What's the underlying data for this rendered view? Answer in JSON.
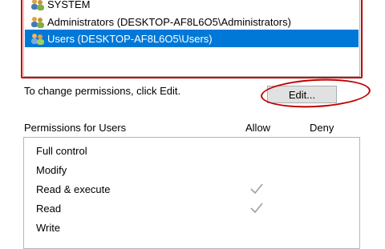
{
  "users": {
    "items": [
      {
        "name": "SYSTEM",
        "selected": false
      },
      {
        "name": "Administrators (DESKTOP-AF8L6O5\\Administrators)",
        "selected": false
      },
      {
        "name": "Users (DESKTOP-AF8L6O5\\Users)",
        "selected": true
      }
    ]
  },
  "hint": "To change permissions, click Edit.",
  "edit_button": "Edit...",
  "permissions": {
    "title": "Permissions for Users",
    "allow_label": "Allow",
    "deny_label": "Deny",
    "rows": [
      {
        "name": "Full control",
        "allow": false,
        "deny": false
      },
      {
        "name": "Modify",
        "allow": false,
        "deny": false
      },
      {
        "name": "Read & execute",
        "allow": true,
        "deny": false
      },
      {
        "name": "Read",
        "allow": true,
        "deny": false
      },
      {
        "name": "Write",
        "allow": false,
        "deny": false
      }
    ]
  },
  "colors": {
    "selection": "#0078d7",
    "annotation": "#c00000",
    "checkmark": "#a0a0a0"
  }
}
